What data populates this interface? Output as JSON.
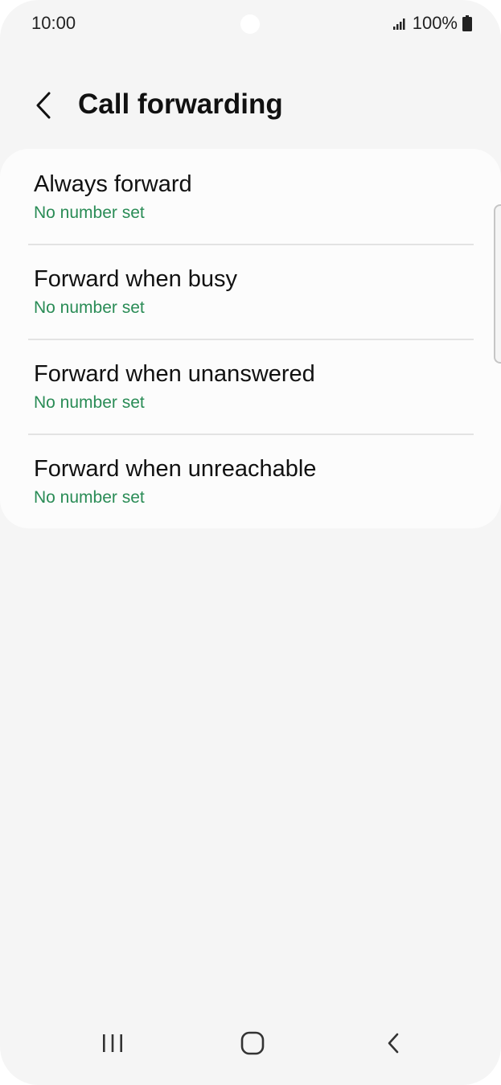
{
  "status_bar": {
    "time": "10:00",
    "battery": "100%",
    "icons": [
      "signal-icon",
      "battery-icon"
    ]
  },
  "header": {
    "title": "Call forwarding",
    "back_icon": "chevron-left-icon"
  },
  "colors": {
    "accent": "#2a8c56",
    "background": "#f5f5f5",
    "card": "#fcfcfc"
  },
  "settings": {
    "items": [
      {
        "title": "Always forward",
        "subtitle": "No number set"
      },
      {
        "title": "Forward when busy",
        "subtitle": "No number set"
      },
      {
        "title": "Forward when unanswered",
        "subtitle": "No number set"
      },
      {
        "title": "Forward when unreachable",
        "subtitle": "No number set"
      }
    ]
  },
  "nav_bar": {
    "buttons": [
      "recent-apps-icon",
      "home-icon",
      "back-icon"
    ]
  }
}
